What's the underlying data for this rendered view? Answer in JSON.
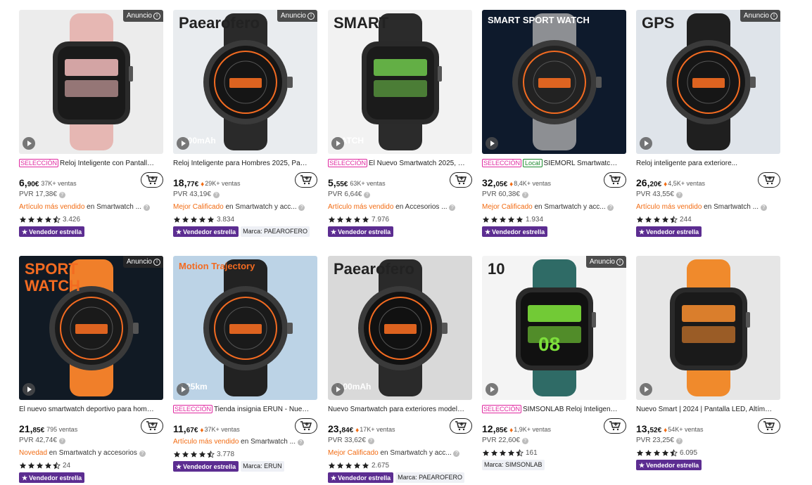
{
  "ad_label": "Anuncio",
  "products": [
    {
      "title": "Reloj Inteligente con Pantalla T...",
      "selection": "SELECCIÓN",
      "local": "",
      "price_int": "6,",
      "price_dec": "90€",
      "sales": "37K+ ventas",
      "fire": false,
      "pvr": "PVR 17,38€",
      "highlight": "Artículo más vendido",
      "category": " en Smartwatch ...",
      "rating": 4.5,
      "rating_count": "3.426",
      "star_badge": "Vendedor estrella",
      "brand": "",
      "ad": true,
      "img_text": [
        "",
        ""
      ],
      "colors": {
        "bg": "#ececec",
        "accent": "#e8b4b4",
        "face": "#1a1a1a",
        "band": "#e6b7b3"
      }
    },
    {
      "title": "Reloj Inteligente para Hombres 2025, Pant...",
      "selection": "",
      "local": "",
      "price_int": "18,",
      "price_dec": "77€",
      "sales": "29K+ ventas",
      "fire": true,
      "pvr": "PVR 43,19€",
      "highlight": "Mejor Calificado",
      "category": " en Smartwatch y acc...",
      "rating": 5,
      "rating_count": "3.834",
      "star_badge": "Vendedor estrella",
      "brand": "Marca: PAEAROFERO",
      "ad": true,
      "img_text": [
        "Paearofero",
        "1100mAh"
      ],
      "colors": {
        "bg": "#e9ecef",
        "accent": "#f36b21",
        "face": "#151515",
        "band": "#2a2a2a"
      }
    },
    {
      "title": "El Nuevo Smartwatch 2025, un...",
      "selection": "SELECCIÓN",
      "local": "",
      "price_int": "5,",
      "price_dec": "55€",
      "sales": "63K+ ventas",
      "fire": false,
      "pvr": "PVR 6,64€",
      "highlight": "Artículo más vendido",
      "category": " en Accesorios ...",
      "rating": 5,
      "rating_count": "7.976",
      "star_badge": "Vendedor estrella",
      "brand": "",
      "ad": false,
      "img_text": [
        "SMART",
        "WATCH"
      ],
      "colors": {
        "bg": "#f2f2f2",
        "accent": "#6cc04a",
        "face": "#1b1b1b",
        "band": "#2b2b2b"
      }
    },
    {
      "title": "SIEMORL Smartwatch p...",
      "selection": "SELECCIÓN",
      "local": "Local",
      "price_int": "32,",
      "price_dec": "05€",
      "sales": "8,4K+ ventas",
      "fire": true,
      "pvr": "PVR 60,38€",
      "highlight": "Mejor Calificado",
      "category": " en Smartwatch y acc...",
      "rating": 5,
      "rating_count": "1.934",
      "star_badge": "Vendedor estrella",
      "brand": "",
      "ad": false,
      "img_text": [
        "SMART SPORT WATCH",
        ""
      ],
      "colors": {
        "bg": "#0e1a2c",
        "accent": "#f36b21",
        "face": "#222",
        "band": "#8d8f93"
      }
    },
    {
      "title": "Reloj inteligente para exteriore...",
      "selection": "",
      "local": "",
      "price_int": "26,",
      "price_dec": "20€",
      "sales": "4,5K+ ventas",
      "fire": true,
      "pvr": "PVR 43,55€",
      "highlight": "Artículo más vendido",
      "category": " en Smartwatch ...",
      "rating": 4.5,
      "rating_count": "244",
      "star_badge": "Vendedor estrella",
      "brand": "",
      "ad": true,
      "img_text": [
        "GPS",
        ""
      ],
      "colors": {
        "bg": "#dfe4ea",
        "accent": "#f36b21",
        "face": "#161616",
        "band": "#1f1f1f"
      }
    },
    {
      "title": "El nuevo smartwatch deportivo para homb...",
      "selection": "",
      "local": "",
      "price_int": "21,",
      "price_dec": "85€",
      "sales": "795 ventas",
      "fire": false,
      "pvr": "PVR 42,74€",
      "highlight": "Novedad",
      "category": " en Smartwatch y accesorios",
      "rating": 4.5,
      "rating_count": "24",
      "star_badge": "Vendedor estrella",
      "brand": "",
      "ad": true,
      "img_text": [
        "SPORT",
        "WATCH"
      ],
      "colors": {
        "bg": "#111a24",
        "accent": "#f36b21",
        "face": "#1a1a1a",
        "band": "#f07f2a"
      }
    },
    {
      "title": "Tienda insignia ERUN - Nuevo ...",
      "selection": "SELECCIÓN",
      "local": "",
      "price_int": "11,",
      "price_dec": "67€",
      "sales": "37K+ ventas",
      "fire": true,
      "pvr": "",
      "highlight": "Artículo más vendido",
      "category": " en Smartwatch ...",
      "rating": 4.5,
      "rating_count": "3.778",
      "star_badge": "Vendedor estrella",
      "brand": "Marca: ERUN",
      "ad": false,
      "img_text": [
        "Motion Trajectory",
        "3.25km"
      ],
      "colors": {
        "bg": "#bcd3e6",
        "accent": "#f36b21",
        "face": "#1a1a1a",
        "band": "#222"
      }
    },
    {
      "title": "Nuevo Smartwatch para exteriores modelo...",
      "selection": "",
      "local": "",
      "price_int": "23,",
      "price_dec": "84€",
      "sales": "17K+ ventas",
      "fire": true,
      "pvr": "PVR 33,62€",
      "highlight": "Mejor Calificado",
      "category": " en Smartwatch y acc...",
      "rating": 5,
      "rating_count": "2.675",
      "star_badge": "Vendedor estrella",
      "brand": "Marca: PAEAROFERO",
      "ad": false,
      "img_text": [
        "Paearofero",
        "1000mAh"
      ],
      "colors": {
        "bg": "#d9d9d9",
        "accent": "#f36b21",
        "face": "#111",
        "band": "#2a2a2a"
      }
    },
    {
      "title": "SIMSONLAB Reloj Inteligente c...",
      "selection": "SELECCIÓN",
      "local": "",
      "price_int": "12,",
      "price_dec": "85€",
      "sales": "1,9K+ ventas",
      "fire": true,
      "pvr": "PVR 22,60€",
      "highlight": "",
      "category": "",
      "rating": 4.5,
      "rating_count": "161",
      "star_badge": "",
      "brand": "Marca: SIMSONLAB",
      "ad": true,
      "img_text": [
        "10",
        "08"
      ],
      "colors": {
        "bg": "#f4f4f4",
        "accent": "#7ddf3b",
        "face": "#111",
        "band": "#2f6b66"
      }
    },
    {
      "title": "Nuevo Smart | 2024 | Pantalla LED, Altímetr...",
      "selection": "",
      "local": "",
      "price_int": "13,",
      "price_dec": "52€",
      "sales": "54K+ ventas",
      "fire": true,
      "pvr": "PVR 23,25€",
      "highlight": "",
      "category": "",
      "rating": 4.5,
      "rating_count": "6.095",
      "star_badge": "Vendedor estrella",
      "brand": "",
      "ad": false,
      "img_text": [
        "",
        ""
      ],
      "colors": {
        "bg": "#e6e6e6",
        "accent": "#f0892f",
        "face": "#1a1a1a",
        "band": "#f08a2c"
      }
    }
  ]
}
